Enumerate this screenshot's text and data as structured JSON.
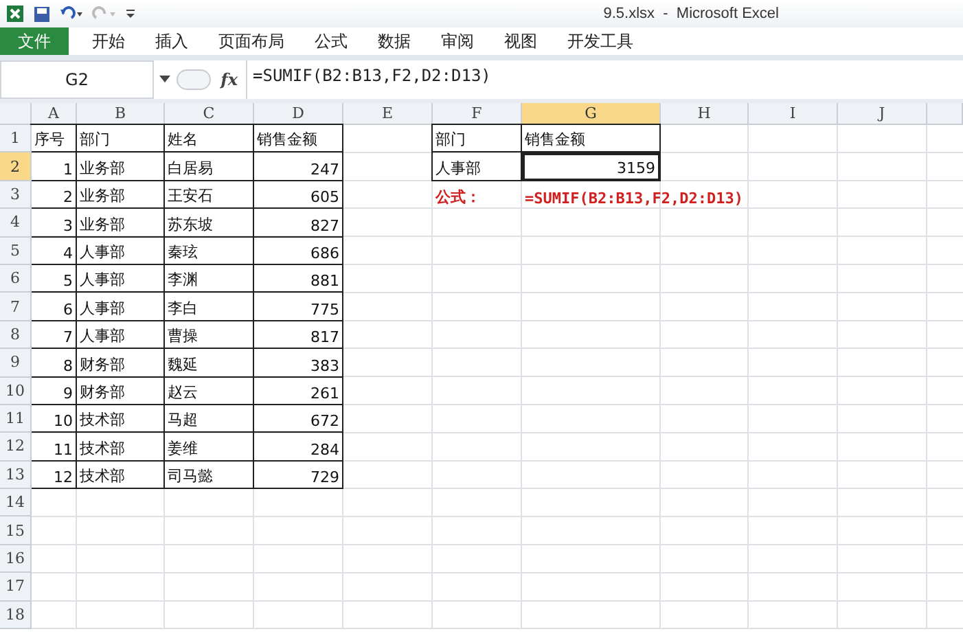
{
  "window": {
    "title": "9.5.xlsx  -  Microsoft Excel"
  },
  "ribbon_tabs": [
    {
      "label": "文件",
      "kind": "file",
      "selected": false
    },
    {
      "label": "开始",
      "kind": "tab",
      "selected": false
    },
    {
      "label": "插入",
      "kind": "tab",
      "selected": false
    },
    {
      "label": "页面布局",
      "kind": "tab",
      "selected": false
    },
    {
      "label": "公式",
      "kind": "tab",
      "selected": false
    },
    {
      "label": "数据",
      "kind": "tab",
      "selected": false
    },
    {
      "label": "审阅",
      "kind": "tab",
      "selected": false
    },
    {
      "label": "视图",
      "kind": "tab",
      "selected": false
    },
    {
      "label": "开发工具",
      "kind": "tab",
      "selected": false
    }
  ],
  "formula_bar": {
    "name_box": "G2",
    "function_label": "fx",
    "formula": "=SUMIF(B2:B13,F2,D2:D13)"
  },
  "sheet": {
    "columns": [
      {
        "label": "A",
        "selected": false
      },
      {
        "label": "B",
        "selected": false
      },
      {
        "label": "C",
        "selected": false
      },
      {
        "label": "D",
        "selected": false
      },
      {
        "label": "E",
        "selected": false
      },
      {
        "label": "F",
        "selected": false
      },
      {
        "label": "G",
        "selected": true
      },
      {
        "label": "H",
        "selected": false
      },
      {
        "label": "I",
        "selected": false
      },
      {
        "label": "J",
        "selected": false
      }
    ],
    "rows": [
      {
        "label": "1",
        "selected": false
      },
      {
        "label": "2",
        "selected": true
      },
      {
        "label": "3",
        "selected": false
      },
      {
        "label": "4",
        "selected": false
      },
      {
        "label": "5",
        "selected": false
      },
      {
        "label": "6",
        "selected": false
      },
      {
        "label": "7",
        "selected": false
      },
      {
        "label": "8",
        "selected": false
      },
      {
        "label": "9",
        "selected": false
      },
      {
        "label": "10",
        "selected": false
      },
      {
        "label": "11",
        "selected": false
      },
      {
        "label": "12",
        "selected": false
      },
      {
        "label": "13",
        "selected": false
      },
      {
        "label": "14",
        "selected": false
      },
      {
        "label": "15",
        "selected": false
      },
      {
        "label": "16",
        "selected": false
      },
      {
        "label": "17",
        "selected": false
      },
      {
        "label": "18",
        "selected": false
      }
    ],
    "table": {
      "columns": [
        "序号",
        "部门",
        "姓名",
        "销售金额"
      ],
      "rows": [
        [
          "1",
          "业务部",
          "白居易",
          "247"
        ],
        [
          "2",
          "业务部",
          "王安石",
          "605"
        ],
        [
          "3",
          "业务部",
          "苏东坡",
          "827"
        ],
        [
          "4",
          "人事部",
          "秦玹",
          "686"
        ],
        [
          "5",
          "人事部",
          "李渊",
          "881"
        ],
        [
          "6",
          "人事部",
          "李白",
          "775"
        ],
        [
          "7",
          "人事部",
          "曹操",
          "817"
        ],
        [
          "8",
          "财务部",
          "魏延",
          "383"
        ],
        [
          "9",
          "财务部",
          "赵云",
          "261"
        ],
        [
          "10",
          "技术部",
          "马超",
          "672"
        ],
        [
          "11",
          "技术部",
          "姜维",
          "284"
        ],
        [
          "12",
          "技术部",
          "司马懿",
          "729"
        ]
      ]
    },
    "lookup": {
      "columns": [
        "部门",
        "销售金额"
      ],
      "criteria": "人事部",
      "result": "3159",
      "result_selected": true
    },
    "formula_note": {
      "label": "公式：",
      "formula": "=SUMIF(B2:B13,F2,D2:D13)"
    }
  }
}
